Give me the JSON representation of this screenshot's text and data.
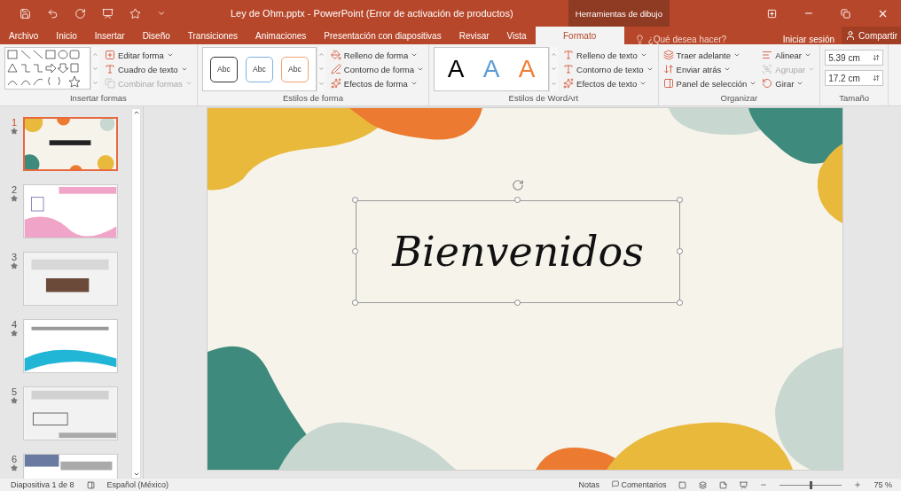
{
  "window": {
    "title": "Ley de Ohm.pptx - PowerPoint (Error de activación de productos)",
    "contextual_tab": "Herramientas de dibujo"
  },
  "tabs": [
    {
      "label": "Archivo",
      "selected": false
    },
    {
      "label": "Inicio",
      "selected": false
    },
    {
      "label": "Insertar",
      "selected": false
    },
    {
      "label": "Diseño",
      "selected": false
    },
    {
      "label": "Transiciones",
      "selected": false
    },
    {
      "label": "Animaciones",
      "selected": false
    },
    {
      "label": "Presentación con diapositivas",
      "selected": false
    },
    {
      "label": "Revisar",
      "selected": false
    },
    {
      "label": "Vista",
      "selected": false
    },
    {
      "label": "Formato",
      "selected": true
    }
  ],
  "search": {
    "placeholder": "¿Qué desea hacer?"
  },
  "account": {
    "sign_in": "Iniciar sesión",
    "share": "Compartir"
  },
  "ribbon": {
    "insert_shapes": {
      "label": "Insertar formas",
      "commands": [
        {
          "label": "Editar forma",
          "disabled": false
        },
        {
          "label": "Cuadro de texto",
          "disabled": false
        },
        {
          "label": "Combinar formas",
          "disabled": true
        }
      ]
    },
    "shape_styles": {
      "label": "Estilos de forma",
      "samples": [
        {
          "text": "Abc",
          "color": "#333333"
        },
        {
          "text": "Abc",
          "color": "#7fb1e0"
        },
        {
          "text": "Abc",
          "color": "#f0a070"
        }
      ],
      "commands": [
        {
          "label": "Relleno de forma",
          "disabled": false
        },
        {
          "label": "Contorno de forma",
          "disabled": false
        },
        {
          "label": "Efectos de forma",
          "disabled": false
        }
      ]
    },
    "wordart_styles": {
      "label": "Estilos de WordArt",
      "samples": [
        {
          "text": "A",
          "color": "#000000"
        },
        {
          "text": "A",
          "color": "#5b9bd5"
        },
        {
          "text": "A",
          "color": "#ed7d31"
        }
      ],
      "commands": [
        {
          "label": "Relleno de texto",
          "disabled": false
        },
        {
          "label": "Contorno de texto",
          "disabled": false
        },
        {
          "label": "Efectos de texto",
          "disabled": false
        }
      ]
    },
    "arrange": {
      "label": "Organizar",
      "commands": [
        {
          "label": "Traer adelante",
          "disabled": false
        },
        {
          "label": "Alinear",
          "disabled": false
        },
        {
          "label": "Enviar atrás",
          "disabled": false
        },
        {
          "label": "Agrupar",
          "disabled": true
        },
        {
          "label": "Panel de selección",
          "disabled": false
        },
        {
          "label": "Girar",
          "disabled": false
        }
      ]
    },
    "size": {
      "label": "Tamaño",
      "height": "5.39 cm",
      "width": "17.2 cm"
    }
  },
  "slides": [
    {
      "number": "1",
      "selected": true
    },
    {
      "number": "2",
      "selected": false
    },
    {
      "number": "3",
      "selected": false
    },
    {
      "number": "4",
      "selected": false
    },
    {
      "number": "5",
      "selected": false
    },
    {
      "number": "6",
      "selected": false
    }
  ],
  "slide": {
    "title": "Bienvenidos"
  },
  "status_bar": {
    "slide_info": "Diapositiva 1 de 8",
    "language": "Español (México)",
    "notes": "Notas",
    "comments": "Comentarios",
    "zoom": "75 %",
    "zoom_level": {
      "level": 0.5
    }
  }
}
